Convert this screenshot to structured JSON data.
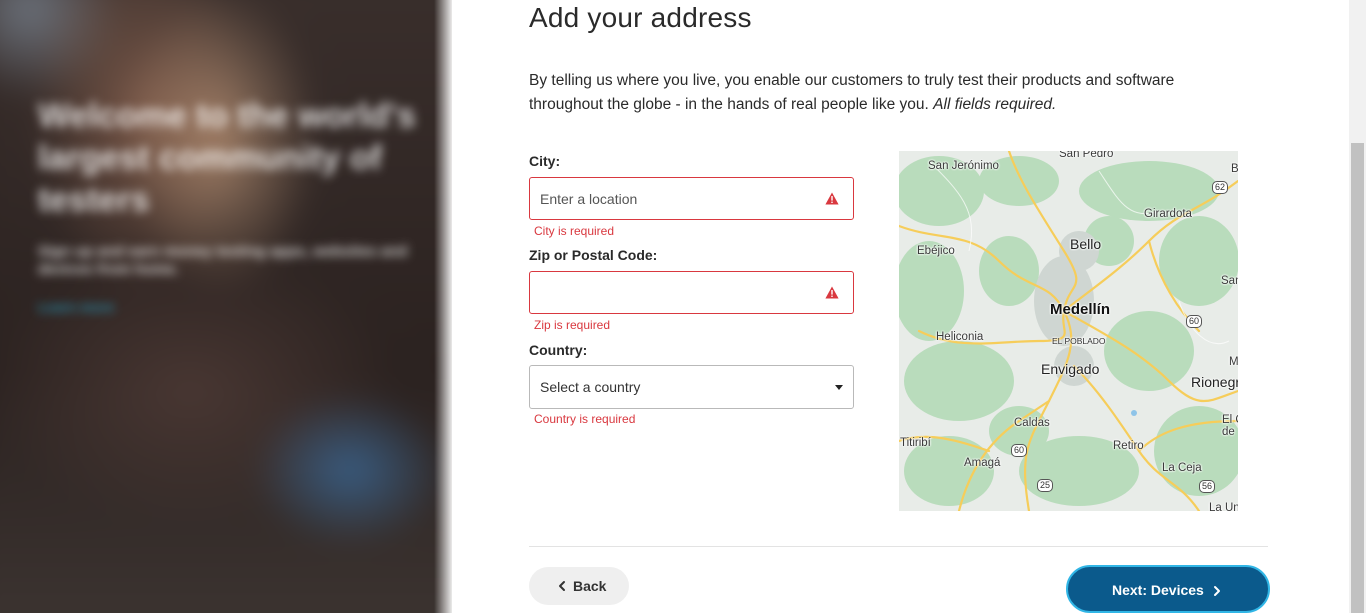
{
  "hero": {
    "title": "Welcome to the world's largest community of testers",
    "subtitle": "Sign up and earn money testing apps, websites and devices from home.",
    "link": "Learn more"
  },
  "page": {
    "title": "Add your address",
    "intro": "By telling us where you live, you enable our customers to truly test their products and software throughout the globe - in the hands of real people like you.",
    "intro_note": "All fields required."
  },
  "form": {
    "city": {
      "label": "City:",
      "placeholder": "Enter a location",
      "value": "",
      "error": "City is required"
    },
    "zip": {
      "label": "Zip or Postal Code:",
      "placeholder": "",
      "value": "",
      "error": "Zip is required"
    },
    "country": {
      "label": "Country:",
      "selected": "Select a country",
      "error": "Country is required"
    }
  },
  "map": {
    "labels": {
      "san_pedro": "San Pedro",
      "san_jeronimo": "San Jerónimo",
      "girardota": "Girardota",
      "bello": "Bello",
      "ebejico": "Ebéjico",
      "medellin": "Medellín",
      "el_poblado": "EL POBLADO",
      "heliconia": "Heliconia",
      "envigado": "Envigado",
      "rionegro": "Rionegr",
      "caldas": "Caldas",
      "retiro": "Retiro",
      "titiribi": "Titiribí",
      "amaga": "Amagá",
      "la_ceja": "La Ceja",
      "san_edge": "San",
      "ma_edge": "Ma",
      "b_edge": "B",
      "el_edge": "El C",
      "de_edge": "de",
      "la_un_edge": "La Un"
    },
    "routes": {
      "r62": "62",
      "r60a": "60",
      "r60b": "60",
      "r25": "25",
      "r56": "56"
    }
  },
  "actions": {
    "back_label": "Back",
    "next_label": "Next: Devices"
  },
  "colors": {
    "error": "#d9383f",
    "primary": "#0b5a8c",
    "focus_ring": "#31b6e6"
  }
}
